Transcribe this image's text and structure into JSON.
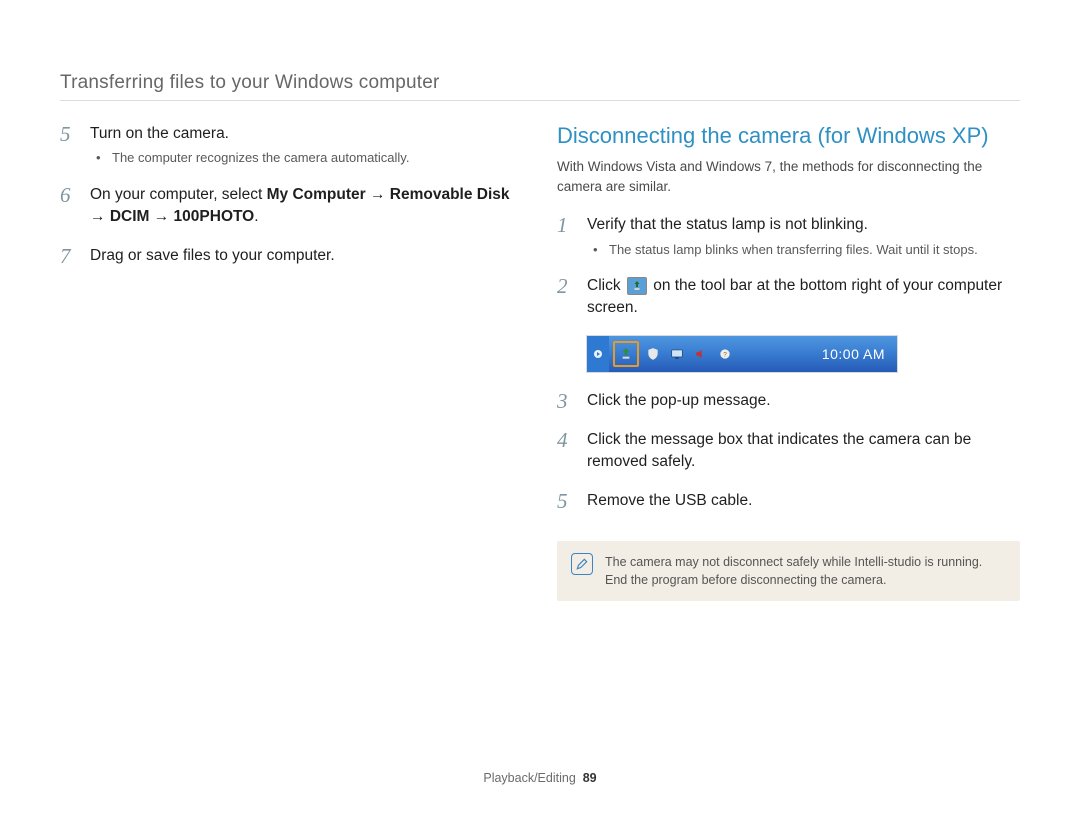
{
  "header": "Transferring files to your Windows computer",
  "left_steps": [
    {
      "num": "5",
      "text": "Turn on the camera.",
      "bullets": [
        "The computer recognizes the camera automatically."
      ]
    },
    {
      "num": "6",
      "text_parts": [
        "On your computer, select ",
        "My Computer",
        " → ",
        "Removable Disk",
        " → ",
        "DCIM",
        " → ",
        "100PHOTO",
        "."
      ]
    },
    {
      "num": "7",
      "text": "Drag or save files to your computer."
    }
  ],
  "right": {
    "title": "Disconnecting the camera (for Windows XP)",
    "intro": "With Windows Vista and Windows 7, the methods for disconnecting the camera are similar.",
    "steps": [
      {
        "num": "1",
        "text": "Verify that the status lamp is not blinking.",
        "bullets": [
          "The status lamp blinks when transferring files. Wait until it stops."
        ]
      },
      {
        "num": "2",
        "pre": "Click ",
        "post": " on the tool bar at the bottom right of your computer screen."
      },
      {
        "num": "3",
        "text": "Click the pop-up message."
      },
      {
        "num": "4",
        "text": "Click the message box that indicates the camera can be removed safely."
      },
      {
        "num": "5",
        "text": "Remove the USB cable."
      }
    ],
    "taskbar_time": "10:00 AM",
    "note": "The camera may not disconnect safely while Intelli-studio is running. End the program before disconnecting the camera."
  },
  "footer_section": "Playback/Editing",
  "footer_page": "89"
}
